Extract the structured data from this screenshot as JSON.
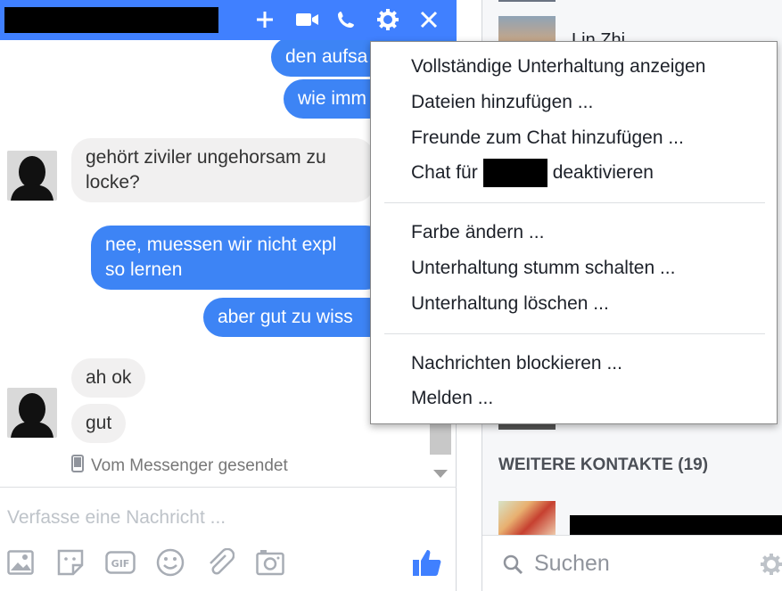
{
  "chat": {
    "title": "",
    "header_icons": [
      "plus-icon",
      "video-camera-icon",
      "phone-icon",
      "gear-icon",
      "close-icon"
    ],
    "messages": [
      {
        "dir": "out",
        "text": "den aufsa"
      },
      {
        "dir": "out",
        "text": "wie imm"
      },
      {
        "dir": "in",
        "text_line1": "gehört ziviler ungehorsam zu",
        "text_line2": "locke?"
      },
      {
        "dir": "out",
        "text_line1": "nee, muessen wir nicht expl",
        "text_line2": "so lernen"
      },
      {
        "dir": "out",
        "text": "aber gut zu wiss"
      },
      {
        "dir": "in",
        "text": "ah ok"
      },
      {
        "dir": "in",
        "text": "gut"
      }
    ],
    "sent_from": "Vom Messenger gesendet",
    "composer_placeholder": "Verfasse eine Nachricht ...",
    "composer_tools": [
      "image-icon",
      "sticker-icon",
      "gif-icon",
      "emoji-icon",
      "attachment-icon",
      "camera-icon",
      "thumbs-up-icon"
    ]
  },
  "menu": {
    "group1": [
      "Vollständige Unterhaltung anzeigen",
      "Dateien hinzufügen ...",
      "Freunde zum Chat hinzufügen ..."
    ],
    "deactivate_prefix": "Chat für",
    "deactivate_suffix": "deaktivieren",
    "group2": [
      "Farbe ändern ...",
      "Unterhaltung stumm schalten ...",
      "Unterhaltung löschen ..."
    ],
    "group3": [
      "Nachrichten blockieren ...",
      "Melden ..."
    ]
  },
  "sidebar": {
    "partial_contact": "Lin Zhi",
    "more_contacts": "WEITERE KONTAKTE (19)",
    "search_placeholder": "Suchen"
  },
  "colors": {
    "header_blue": "#4080ff",
    "outgoing_bubble": "#3d84f5",
    "incoming_bubble": "#f1f0f0"
  }
}
